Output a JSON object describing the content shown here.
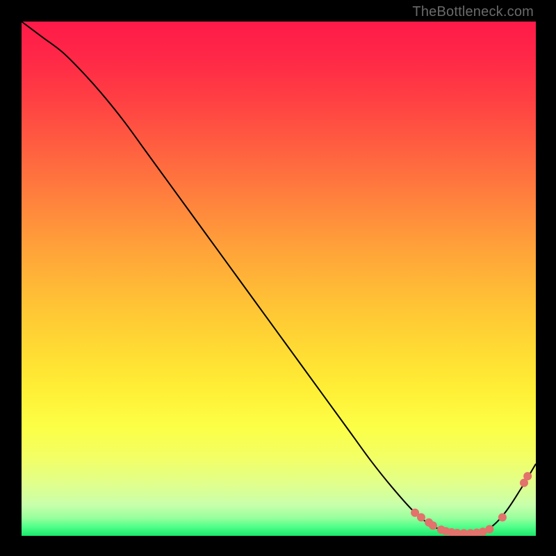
{
  "watermark": {
    "text": "TheBottleneck.com"
  },
  "gradient": {
    "stops": [
      {
        "offset": 0.0,
        "color": "#ff1a49"
      },
      {
        "offset": 0.07,
        "color": "#ff2847"
      },
      {
        "offset": 0.15,
        "color": "#ff3f43"
      },
      {
        "offset": 0.25,
        "color": "#ff6140"
      },
      {
        "offset": 0.35,
        "color": "#ff833d"
      },
      {
        "offset": 0.45,
        "color": "#ffa539"
      },
      {
        "offset": 0.55,
        "color": "#ffc335"
      },
      {
        "offset": 0.65,
        "color": "#ffde33"
      },
      {
        "offset": 0.72,
        "color": "#fff036"
      },
      {
        "offset": 0.79,
        "color": "#fcff47"
      },
      {
        "offset": 0.85,
        "color": "#f2ff66"
      },
      {
        "offset": 0.9,
        "color": "#e0ff8c"
      },
      {
        "offset": 0.94,
        "color": "#c8ffab"
      },
      {
        "offset": 0.965,
        "color": "#98ff9e"
      },
      {
        "offset": 0.982,
        "color": "#52ff8a"
      },
      {
        "offset": 1.0,
        "color": "#18e86a"
      }
    ]
  },
  "marker_color": "#e2726b",
  "chart_data": {
    "type": "line",
    "title": "",
    "xlabel": "",
    "ylabel": "",
    "xlim": [
      0,
      100
    ],
    "ylim": [
      0,
      100
    ],
    "series": [
      {
        "name": "bottleneck-curve",
        "x": [
          0,
          4,
          8,
          12,
          16,
          20,
          24,
          28,
          32,
          36,
          40,
          44,
          48,
          52,
          56,
          60,
          64,
          68,
          72,
          76,
          79,
          82,
          85,
          88,
          91,
          94,
          97,
          100
        ],
        "y": [
          100,
          97,
          94,
          90,
          85.5,
          80.5,
          75,
          69.5,
          64,
          58.5,
          53,
          47.5,
          42,
          36.5,
          31,
          25.5,
          20,
          14.5,
          9.5,
          5,
          2.5,
          1,
          0.5,
          0.5,
          1.5,
          4.5,
          9,
          14
        ]
      }
    ],
    "markers": [
      {
        "x": 76.5,
        "y": 4.5
      },
      {
        "x": 77.7,
        "y": 3.6
      },
      {
        "x": 79.2,
        "y": 2.6
      },
      {
        "x": 80.0,
        "y": 2.0
      },
      {
        "x": 81.6,
        "y": 1.2
      },
      {
        "x": 82.5,
        "y": 0.9
      },
      {
        "x": 83.6,
        "y": 0.7
      },
      {
        "x": 84.7,
        "y": 0.55
      },
      {
        "x": 86.0,
        "y": 0.5
      },
      {
        "x": 87.3,
        "y": 0.5
      },
      {
        "x": 88.5,
        "y": 0.6
      },
      {
        "x": 89.7,
        "y": 0.8
      },
      {
        "x": 91.0,
        "y": 1.3
      },
      {
        "x": 93.5,
        "y": 3.6
      },
      {
        "x": 97.7,
        "y": 10.3
      },
      {
        "x": 98.4,
        "y": 11.6
      }
    ]
  }
}
